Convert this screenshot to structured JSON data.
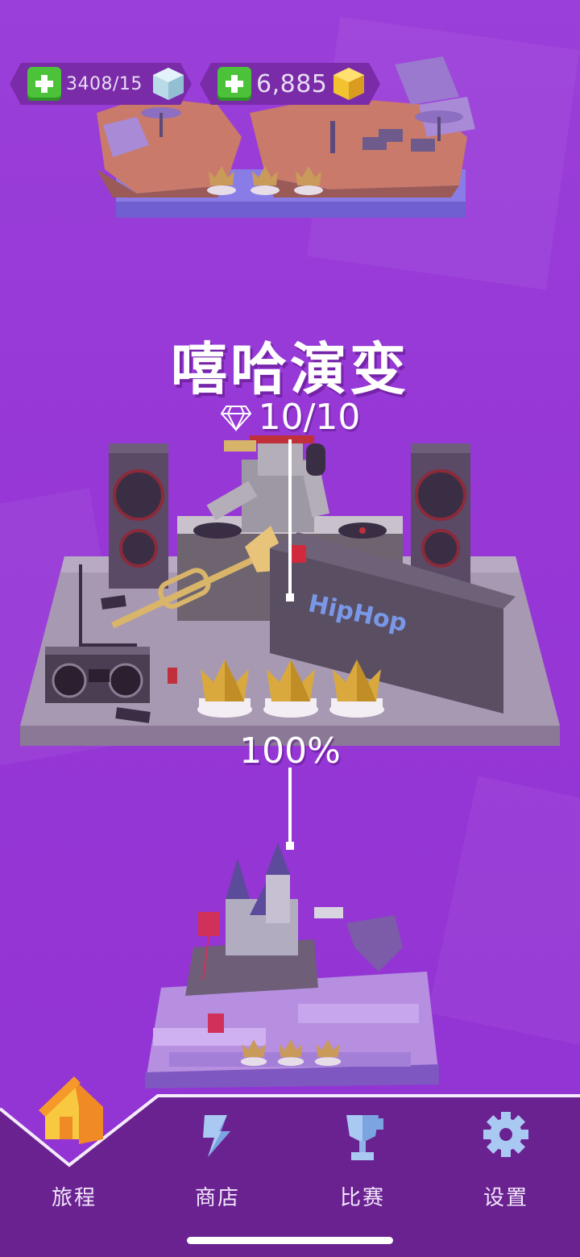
{
  "hud": {
    "energy_value": "3408/15",
    "gem_value": "6,885",
    "energy_icon": "ice-cube-icon",
    "gem_icon": "gold-cube-icon",
    "add_icon": "plus-icon"
  },
  "level": {
    "title": "嘻哈演变",
    "diamonds": "10/10",
    "progress": "100%",
    "progress_fraction": 1.0,
    "crowns_earned": 3
  },
  "nav": {
    "items": [
      {
        "label": "旅程",
        "icon": "house-icon",
        "active": true
      },
      {
        "label": "商店",
        "icon": "shop-icon",
        "active": false
      },
      {
        "label": "比赛",
        "icon": "trophy-icon",
        "active": false
      },
      {
        "label": "设置",
        "icon": "gear-icon",
        "active": false
      }
    ]
  },
  "colors": {
    "background": "#9a3fd9",
    "nav_bar": "#6a2290",
    "plus_green": "#4cc23a",
    "gold": "#f2c230",
    "crown": "#d9a93e"
  }
}
